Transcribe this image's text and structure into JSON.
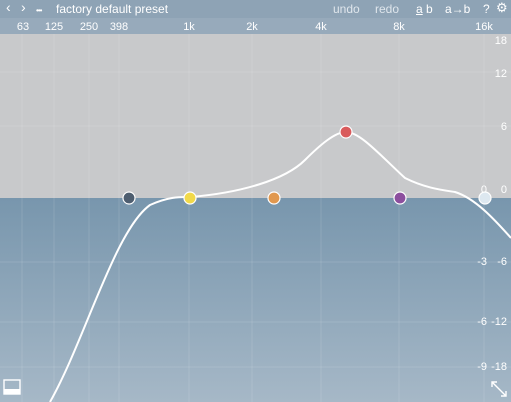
{
  "toolbar": {
    "prev_icon": "‹",
    "next_icon": "›",
    "menu_icon": "•••",
    "preset_name": "factory default preset",
    "undo_label": "undo",
    "redo_label": "redo",
    "ab_a": "a",
    "ab_b": "b",
    "copy_label": "a→b",
    "help_label": "?",
    "settings_icon": "⚙"
  },
  "freq_labels": [
    "63",
    "125",
    "250",
    "398",
    "1k",
    "2k",
    "4k",
    "8k",
    "16k"
  ],
  "gain_labels_right": [
    "18",
    "12",
    "6",
    "0",
    "-6",
    "-12",
    "-18"
  ],
  "gain_labels_inner": [
    "0",
    "-3",
    "-6",
    "-9"
  ],
  "bands": [
    {
      "color": "#4e5e70"
    },
    {
      "color": "#f1d94a"
    },
    {
      "color": "#e1984f"
    },
    {
      "color": "#d95b5c"
    },
    {
      "color": "#8c4f9e"
    },
    {
      "color": "#dde8f0"
    }
  ],
  "colors": {
    "curve": "#ffffff",
    "upper_bg": "#c8c9cb",
    "lower_bg": "#7896ad"
  },
  "icons": {
    "panel_toggle": "panel-icon",
    "resize": "resize-icon"
  }
}
